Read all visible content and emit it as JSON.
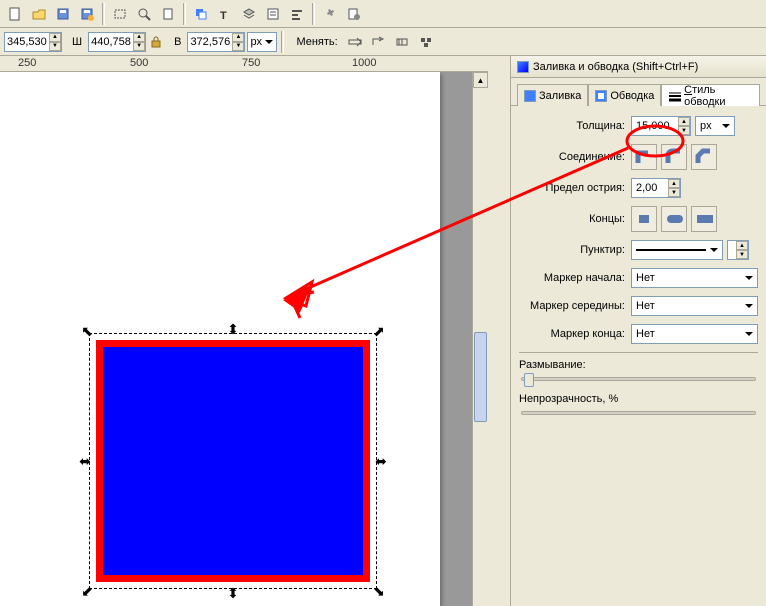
{
  "toolbar1": {
    "icons": [
      "new-doc",
      "open-doc",
      "save",
      "save-as",
      "zoom-fit",
      "zoom-sel",
      "zoom-page",
      "arrow",
      "text",
      "align",
      "group",
      "xml-edit",
      "transform",
      "prefs",
      "prefs2"
    ]
  },
  "toolbar2": {
    "x_value": "345,530",
    "w_label": "Ш",
    "w_value": "440,758",
    "h_label": "В",
    "h_value": "372,576",
    "unit": "px",
    "change_label": "Менять:"
  },
  "ruler": {
    "marks": [
      "250",
      "500",
      "750",
      "1000"
    ]
  },
  "dock": {
    "title": "Заливка и обводка (Shift+Ctrl+F)",
    "tabs": {
      "fill": "Заливка",
      "stroke": "Обводка",
      "style": "Стиль обводки",
      "style_accel": "С"
    },
    "thickness_label": "Толщина:",
    "thickness_value": "15,000",
    "thickness_unit": "px",
    "join_label": "Соединение:",
    "miter_label": "Предел острия:",
    "miter_value": "2,00",
    "cap_label": "Концы:",
    "dash_label": "Пунктир:",
    "marker_start_label": "Маркер начала:",
    "marker_mid_label": "Маркер середины:",
    "marker_end_label": "Маркер конца:",
    "marker_none": "Нет",
    "blur_label": "Размывание:",
    "opacity_label": "Непрозрачность, %"
  }
}
